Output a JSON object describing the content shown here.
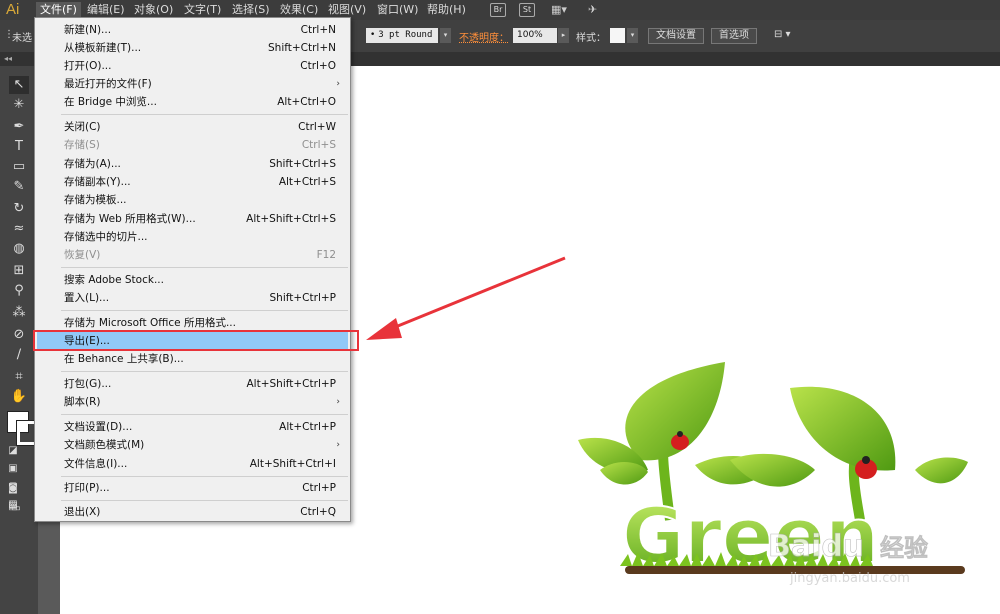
{
  "app": {
    "logo": "Ai"
  },
  "menubar": {
    "items": [
      "文件(F)",
      "编辑(E)",
      "对象(O)",
      "文字(T)",
      "选择(S)",
      "效果(C)",
      "视图(V)",
      "窗口(W)",
      "帮助(H)"
    ],
    "badges": [
      "Br",
      "St"
    ]
  },
  "controlbar": {
    "unselected_label": "未选",
    "stroke_profile": "3 pt Round",
    "opacity_label": "不透明度：",
    "opacity_value": "100%",
    "style_label": "样式：",
    "doc_settings_button": "文档设置",
    "preferences_button": "首选项"
  },
  "file_menu": {
    "items": [
      {
        "label": "新建(N)...",
        "shortcut": "Ctrl+N"
      },
      {
        "label": "从模板新建(T)...",
        "shortcut": "Shift+Ctrl+N"
      },
      {
        "label": "打开(O)...",
        "shortcut": "Ctrl+O"
      },
      {
        "label": "最近打开的文件(F)",
        "shortcut": ""
      },
      {
        "label": "在 Bridge 中浏览...",
        "shortcut": "Alt+Ctrl+O"
      },
      {
        "label": "关闭(C)",
        "shortcut": "Ctrl+W"
      },
      {
        "label": "存储(S)",
        "shortcut": "Ctrl+S"
      },
      {
        "label": "存储为(A)...",
        "shortcut": "Shift+Ctrl+S"
      },
      {
        "label": "存储副本(Y)...",
        "shortcut": "Alt+Ctrl+S"
      },
      {
        "label": "存储为模板...",
        "shortcut": ""
      },
      {
        "label": "存储为 Web 所用格式(W)...",
        "shortcut": "Alt+Shift+Ctrl+S"
      },
      {
        "label": "存储选中的切片...",
        "shortcut": ""
      },
      {
        "label": "恢复(V)",
        "shortcut": "F12"
      },
      {
        "label": "搜索 Adobe Stock...",
        "shortcut": ""
      },
      {
        "label": "置入(L)...",
        "shortcut": "Shift+Ctrl+P"
      },
      {
        "label": "存储为 Microsoft Office 所用格式...",
        "shortcut": ""
      },
      {
        "label": "导出(E)...",
        "shortcut": ""
      },
      {
        "label": "在 Behance 上共享(B)...",
        "shortcut": ""
      },
      {
        "label": "打包(G)...",
        "shortcut": "Alt+Shift+Ctrl+P"
      },
      {
        "label": "脚本(R)",
        "shortcut": ""
      },
      {
        "label": "文档设置(D)...",
        "shortcut": "Alt+Ctrl+P"
      },
      {
        "label": "文档颜色模式(M)",
        "shortcut": ""
      },
      {
        "label": "文件信息(I)...",
        "shortcut": "Alt+Shift+Ctrl+I"
      },
      {
        "label": "打印(P)...",
        "shortcut": "Ctrl+P"
      },
      {
        "label": "退出(X)",
        "shortcut": "Ctrl+Q"
      }
    ]
  },
  "artwork": {
    "word": "Green"
  },
  "watermark": {
    "brand": "Baidu",
    "suffix": "经验",
    "url": "jingyan.baidu.com"
  },
  "colors": {
    "highlight": "#91c9f7",
    "annotation_red": "#e8333a",
    "leaf_green": "#7cc31f"
  }
}
